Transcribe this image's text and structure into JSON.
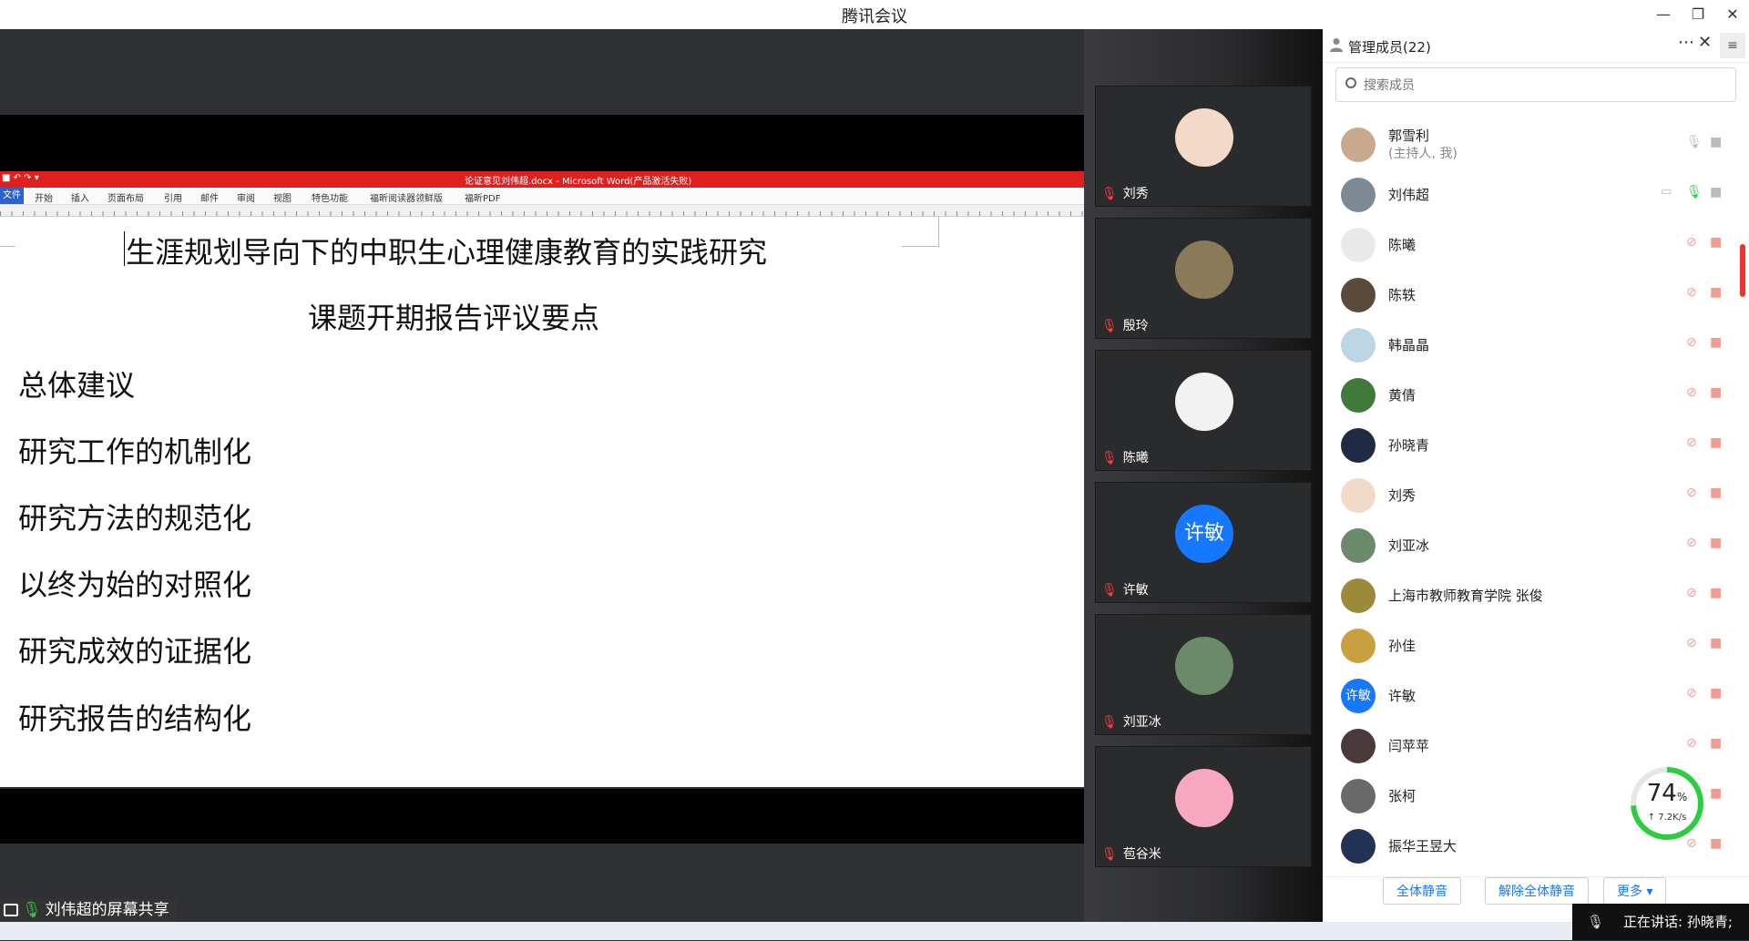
{
  "app": {
    "title": "腾讯会议"
  },
  "window_controls": {
    "minimize": "—",
    "restore": "❐",
    "close": "✕"
  },
  "word": {
    "titlebar": "论证意见刘伟超.docx - Microsoft Word(产品激活失败)",
    "file_tab": "文件",
    "tabs": [
      "开始",
      "插入",
      "页面布局",
      "引用",
      "邮件",
      "审阅",
      "视图",
      "特色功能",
      "福昕阅读器领鲜版",
      "福昕PDF"
    ]
  },
  "document": {
    "title": "生涯规划导向下的中职生心理健康教育的实践研究",
    "subtitle": "课题开期报告评议要点",
    "lines": [
      "总体建议",
      "研究工作的机制化",
      "研究方法的规范化",
      "以终为始的对照化",
      "研究成效的证据化",
      "研究报告的结构化"
    ]
  },
  "screen_share": {
    "label": "刘伟超的屏幕共享"
  },
  "video_tiles": [
    {
      "name": "刘秀",
      "color": "#f3d9c8"
    },
    {
      "name": "殷玲",
      "color": "#8a7a5a"
    },
    {
      "name": "陈曦",
      "color": "#f2f2f2"
    },
    {
      "name": "许敏",
      "color": "#1677ff",
      "avatar_text": "许敏"
    },
    {
      "name": "刘亚冰",
      "color": "#6a8a6a"
    },
    {
      "name": "苞谷米",
      "color": "#f7a8c0"
    }
  ],
  "panel": {
    "title": "管理成员(22)",
    "search_placeholder": "搜索成员",
    "members": [
      {
        "name": "郭雪利",
        "sub": "(主持人, 我)",
        "color": "#c9a98d",
        "mic": "idle",
        "cam": "idle"
      },
      {
        "name": "刘伟超",
        "color": "#7e8a93",
        "mic": "on",
        "cam": "idle",
        "screen": true
      },
      {
        "name": "陈曦",
        "color": "#e9e9e9",
        "mic": "off",
        "cam": "off"
      },
      {
        "name": "陈轶",
        "color": "#5b4a3a",
        "mic": "off",
        "cam": "off"
      },
      {
        "name": "韩晶晶",
        "color": "#bcd6e6",
        "mic": "off",
        "cam": "off"
      },
      {
        "name": "黄倩",
        "color": "#3f7a3a",
        "mic": "off",
        "cam": "off"
      },
      {
        "name": "孙晓青",
        "color": "#1f2a44",
        "mic": "off",
        "cam": "off"
      },
      {
        "name": "刘秀",
        "color": "#f3d9c8",
        "mic": "off",
        "cam": "off"
      },
      {
        "name": "刘亚冰",
        "color": "#6a8a6a",
        "mic": "off",
        "cam": "off"
      },
      {
        "name": "上海市教师教育学院  张俊",
        "color": "#9a8a3a",
        "mic": "off",
        "cam": "off"
      },
      {
        "name": "孙佳",
        "color": "#c8a040",
        "mic": "off",
        "cam": "off"
      },
      {
        "name": "许敏",
        "color": "#1677ff",
        "avatar_text": "许敏",
        "mic": "off",
        "cam": "off"
      },
      {
        "name": "闫苹苹",
        "color": "#4a3a3a",
        "mic": "off",
        "cam": "off"
      },
      {
        "name": "张柯",
        "color": "#6a6a6a",
        "mic": "off",
        "cam": "off"
      },
      {
        "name": "振华王昱大",
        "color": "#233355",
        "mic": "off",
        "cam": "off"
      }
    ],
    "buttons": {
      "mute_all": "全体静音",
      "unmute_all": "解除全体静音",
      "more": "更多 ▾"
    }
  },
  "network": {
    "percent": "74",
    "unit": "%",
    "speed": "↑ 7.2K/s"
  },
  "speaking": {
    "text": "正在讲话: 孙晓青;"
  }
}
